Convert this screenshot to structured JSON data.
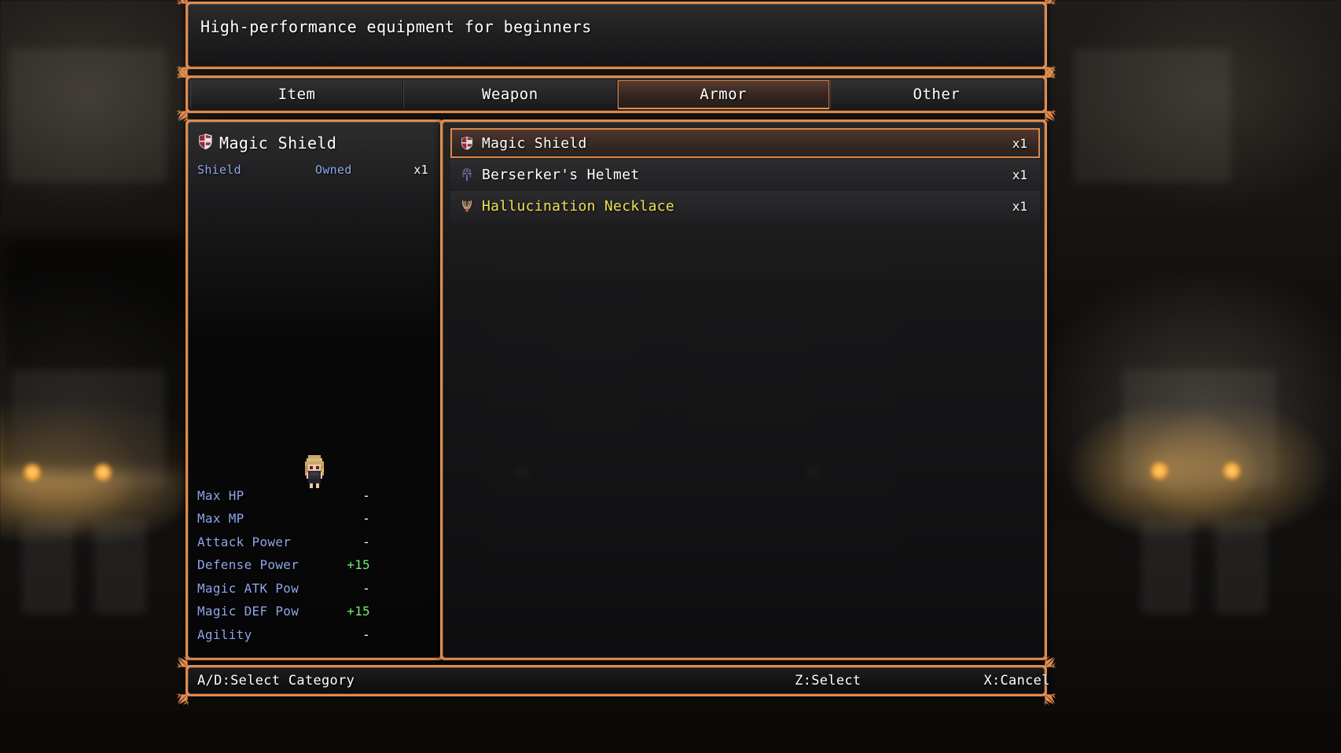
{
  "help": {
    "text": "High-performance equipment for beginners"
  },
  "categories": {
    "tabs": [
      {
        "label": "Item",
        "selected": false
      },
      {
        "label": "Weapon",
        "selected": false
      },
      {
        "label": "Armor",
        "selected": true
      },
      {
        "label": "Other",
        "selected": false
      }
    ]
  },
  "detail": {
    "icon": "shield-icon",
    "name": "Magic Shield",
    "type": "Shield",
    "owned_label": "Owned",
    "owned_count": "x1",
    "sprite": "character-sprite",
    "stats": [
      {
        "label": "Max HP",
        "value": "-",
        "positive": false
      },
      {
        "label": "Max MP",
        "value": "-",
        "positive": false
      },
      {
        "label": "Attack Power",
        "value": "-",
        "positive": false
      },
      {
        "label": "Defense Power",
        "value": "+15",
        "positive": true
      },
      {
        "label": "Magic ATK Pow",
        "value": "-",
        "positive": false
      },
      {
        "label": "Magic DEF Pow",
        "value": "+15",
        "positive": true
      },
      {
        "label": "Agility",
        "value": "-",
        "positive": false
      }
    ]
  },
  "item_list": {
    "rows": [
      {
        "icon": "shield-icon",
        "name": "Magic Shield",
        "qty": "x1",
        "selected": true,
        "special": false
      },
      {
        "icon": "helmet-icon",
        "name": "Berserker's Helmet",
        "qty": "x1",
        "selected": false,
        "special": false
      },
      {
        "icon": "necklace-icon",
        "name": "Hallucination Necklace",
        "qty": "x1",
        "selected": false,
        "special": true
      }
    ]
  },
  "footer": {
    "select_category": "A/D:Select Category",
    "select": "Z:Select",
    "cancel": "X:Cancel"
  },
  "colors": {
    "frame": "#e08c4e",
    "label_blue": "#8fa6e8",
    "stat_up_green": "#6ff06f",
    "special_yellow": "#f0e055",
    "text_white": "#ffffff"
  }
}
